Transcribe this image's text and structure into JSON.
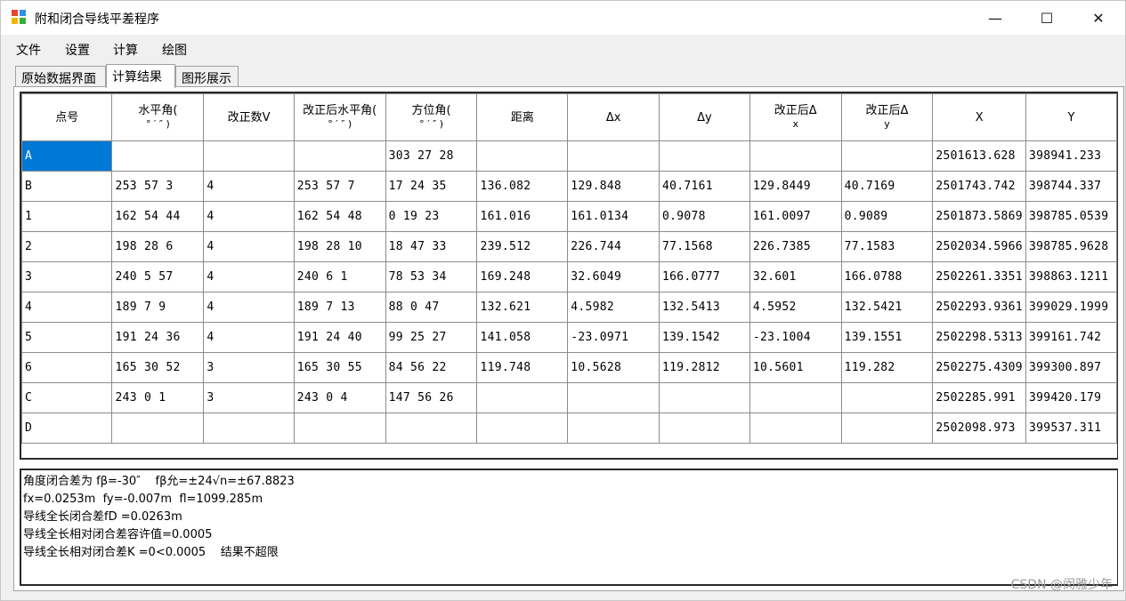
{
  "window": {
    "title": "附和闭合导线平差程序",
    "controls": {
      "minimize": "—",
      "maximize": "☐",
      "close": "✕"
    }
  },
  "menu": [
    "文件",
    "设置",
    "计算",
    "绘图"
  ],
  "tabs": [
    {
      "label": "原始数据界面",
      "active": false
    },
    {
      "label": "计算结果",
      "active": true
    },
    {
      "label": "图形展示",
      "active": false
    }
  ],
  "table": {
    "headers": [
      {
        "main": "点号",
        "sub": ""
      },
      {
        "main": "水平角(",
        "sub": "° ′ ″ )"
      },
      {
        "main": "改正数V",
        "sub": ""
      },
      {
        "main": "改正后水平角(",
        "sub": "° ′ ″ )"
      },
      {
        "main": "方位角(",
        "sub": "° ′ ″ )"
      },
      {
        "main": "距离",
        "sub": ""
      },
      {
        "main": "Δx",
        "sub": ""
      },
      {
        "main": "Δy",
        "sub": ""
      },
      {
        "main": "改正后Δ",
        "sub": "x"
      },
      {
        "main": "改正后Δ",
        "sub": "y"
      },
      {
        "main": "X",
        "sub": ""
      },
      {
        "main": "Y",
        "sub": ""
      }
    ],
    "rows": [
      [
        "A",
        "",
        "",
        "",
        "303 27 28",
        "",
        "",
        "",
        "",
        "",
        "2501613.628",
        "398941.233"
      ],
      [
        "B",
        "253 57 3",
        "4",
        "253 57 7",
        "17 24 35",
        "136.082",
        "129.848",
        "40.7161",
        "129.8449",
        "40.7169",
        "2501743.742",
        "398744.337"
      ],
      [
        "1",
        "162 54 44",
        "4",
        "162 54 48",
        "0 19 23",
        "161.016",
        "161.0134",
        "0.9078",
        "161.0097",
        "0.9089",
        "2501873.5869",
        "398785.0539"
      ],
      [
        "2",
        "198 28 6",
        "4",
        "198 28 10",
        "18 47 33",
        "239.512",
        "226.744",
        "77.1568",
        "226.7385",
        "77.1583",
        "2502034.5966",
        "398785.9628"
      ],
      [
        "3",
        "240 5 57",
        "4",
        "240 6 1",
        "78 53 34",
        "169.248",
        "32.6049",
        "166.0777",
        "32.601",
        "166.0788",
        "2502261.3351",
        "398863.1211"
      ],
      [
        "4",
        "189 7 9",
        "4",
        "189 7 13",
        "88 0 47",
        "132.621",
        "4.5982",
        "132.5413",
        "4.5952",
        "132.5421",
        "2502293.9361",
        "399029.1999"
      ],
      [
        "5",
        "191 24 36",
        "4",
        "191 24 40",
        "99 25 27",
        "141.058",
        "-23.0971",
        "139.1542",
        "-23.1004",
        "139.1551",
        "2502298.5313",
        "399161.742"
      ],
      [
        "6",
        "165 30 52",
        "3",
        "165 30 55",
        "84 56 22",
        "119.748",
        "10.5628",
        "119.2812",
        "10.5601",
        "119.282",
        "2502275.4309",
        "399300.897"
      ],
      [
        "C",
        "243 0 1",
        "3",
        "243 0 4",
        "147 56 26",
        "",
        "",
        "",
        "",
        "",
        "2502285.991",
        "399420.179"
      ],
      [
        "D",
        "",
        "",
        "",
        "",
        "",
        "",
        "",
        "",
        "",
        "2502098.973",
        "399537.311"
      ]
    ],
    "selected_cell": "A"
  },
  "results": [
    "角度闭合差为 fβ=-30″    fβ允=±24√n=±67.8823",
    "fx=0.0253m  fy=-0.007m  fl=1099.285m",
    "导线全长闭合差fD =0.0263m",
    "导线全长相对闭合差容许值=0.0005",
    "导线全长相对闭合差K =0<0.0005    结果不超限"
  ],
  "watermark": "CSDN @闵雅少年"
}
